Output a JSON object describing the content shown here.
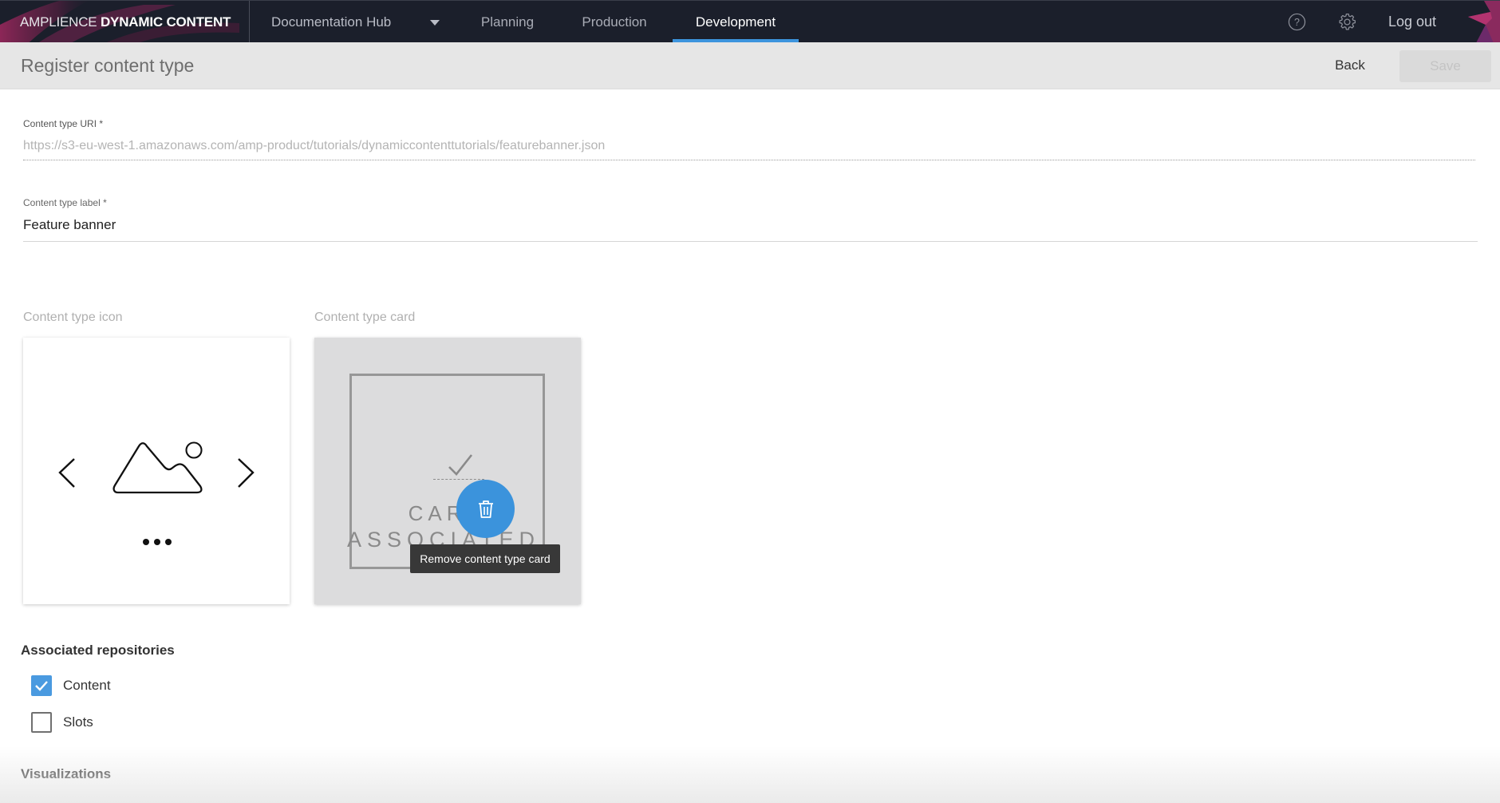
{
  "topbar": {
    "brand_light": "AMPLIENCE ",
    "brand_bold": "DYNAMIC CONTENT",
    "hub_label": "Documentation Hub",
    "tabs": [
      {
        "label": "Planning",
        "active": false
      },
      {
        "label": "Production",
        "active": false
      },
      {
        "label": "Development",
        "active": true
      }
    ],
    "help_icon": "question-circle-icon",
    "settings_icon": "gear-icon",
    "logout_label": "Log out"
  },
  "header": {
    "title": "Register content type",
    "back_label": "Back",
    "save_label": "Save",
    "save_disabled": true
  },
  "form": {
    "uri_label": "Content type URI *",
    "uri_value": "https://s3-eu-west-1.amazonaws.com/amp-product/tutorials/dynamiccontenttutorials/featurebanner.json",
    "label_label": "Content type label *",
    "label_value": "Feature banner"
  },
  "previews": {
    "icon_caption": "Content type icon",
    "card_caption": "Content type card",
    "card_text_top": "CARD",
    "card_text_bottom": "ASSOCIATED",
    "remove_tooltip": "Remove content type card",
    "icon_glyphs": [
      "chevron-left-icon",
      "landscape-image-icon",
      "chevron-right-icon",
      "more-dots-icon"
    ]
  },
  "repositories": {
    "title": "Associated repositories",
    "items": [
      {
        "label": "Content",
        "checked": true
      },
      {
        "label": "Slots",
        "checked": false
      }
    ]
  },
  "visualizations": {
    "title": "Visualizations"
  },
  "colors": {
    "accent": "#3d94dd",
    "topbar_bg": "#1b1f2b",
    "header_bg": "#e6e6e6",
    "brand_magenta": "#b0306a"
  }
}
